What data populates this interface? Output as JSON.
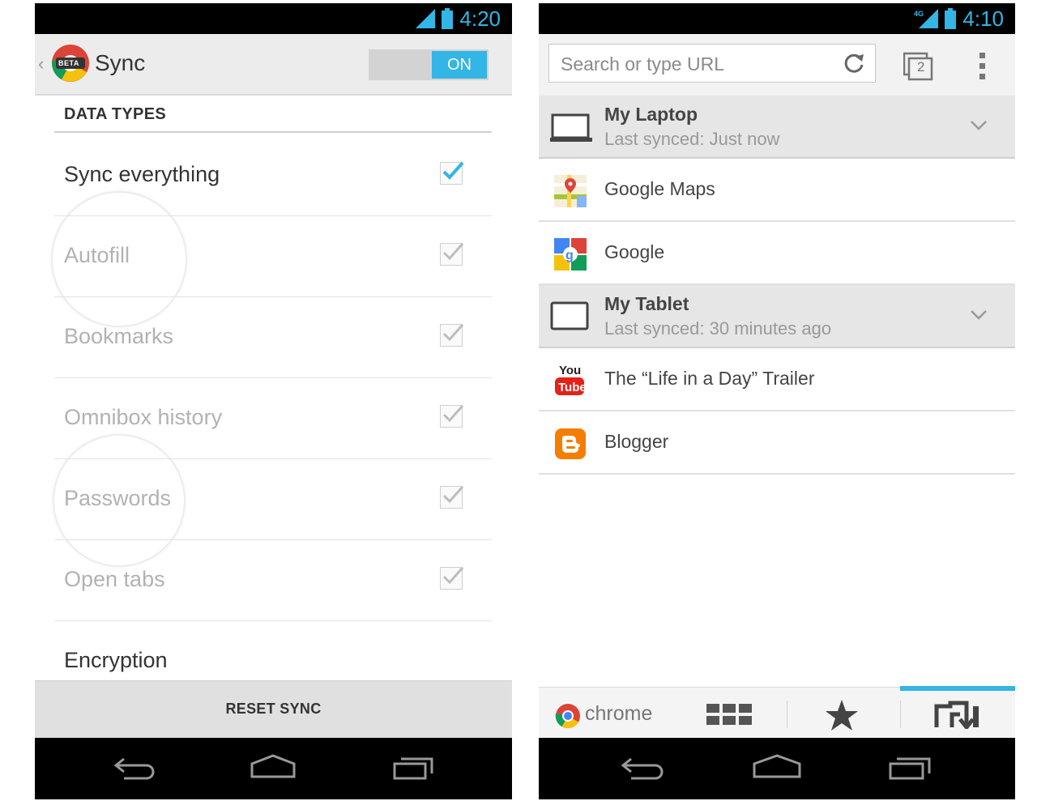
{
  "left": {
    "status_time": "4:20",
    "app_title": "Sync",
    "app_badge": "BETA",
    "toggle_label": "ON",
    "section_header": "DATA TYPES",
    "rows": [
      {
        "label": "Sync everything",
        "checked": true,
        "enabled": true
      },
      {
        "label": "Autofill",
        "checked": true,
        "enabled": false
      },
      {
        "label": "Bookmarks",
        "checked": true,
        "enabled": false
      },
      {
        "label": "Omnibox history",
        "checked": true,
        "enabled": false
      },
      {
        "label": "Passwords",
        "checked": true,
        "enabled": false
      },
      {
        "label": "Open tabs",
        "checked": true,
        "enabled": false
      },
      {
        "label": "Encryption"
      }
    ],
    "reset_label": "RESET SYNC"
  },
  "right": {
    "status_time": "4:10",
    "url_placeholder": "Search or type URL",
    "tab_count": "2",
    "devices": [
      {
        "name": "My Laptop",
        "last_synced": "Last synced: Just now",
        "icon": "laptop-icon",
        "tabs": [
          {
            "title": "Google  Maps",
            "icon": "google-maps-icon"
          },
          {
            "title": "Google",
            "icon": "google-icon"
          }
        ]
      },
      {
        "name": "My Tablet",
        "last_synced": "Last synced: 30 minutes ago",
        "icon": "tablet-icon",
        "tabs": [
          {
            "title": "The “Life in a Day” Trailer",
            "icon": "youtube-icon"
          },
          {
            "title": "Blogger",
            "icon": "blogger-icon"
          }
        ]
      }
    ],
    "bottom_brand": "chrome"
  },
  "colors": {
    "accent": "#33b5e5",
    "disabled_text": "#b2b2b2",
    "blogger": "#f57d00",
    "youtube": "#e62117"
  }
}
